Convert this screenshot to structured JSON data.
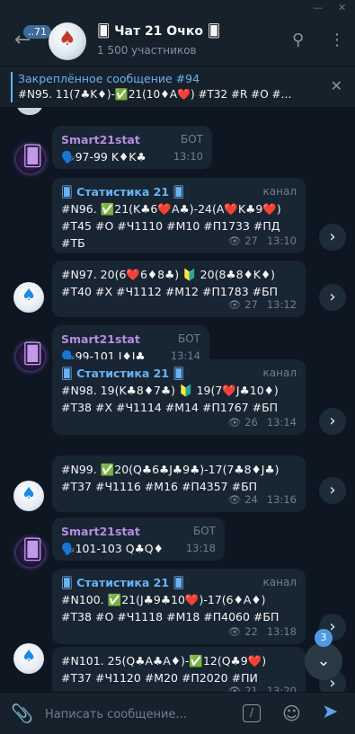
{
  "window": {
    "minimize": "—",
    "close": "✕"
  },
  "header": {
    "back_icon": "arrow-left-icon",
    "unread_count": "..71",
    "title": "🂠 Чат 21 Очко 🂠",
    "subtitle": "1 500 участников",
    "search_icon": "search-icon",
    "menu_icon": "more-vertical-icon"
  },
  "pinned": {
    "title": "Закреплённое сообщение #94",
    "text": "#N95. 11(7♣K♦)-✅21(10♦A❤️) #T32 #R #O #…"
  },
  "messages": [
    {
      "type": "bot",
      "sender": "Smart21stat",
      "tag": "БОТ",
      "text": "🗣️97-99 K♦K♣",
      "time": "13:10"
    },
    {
      "type": "forward",
      "channel": "🂠 Статистика 21 🂠",
      "tag": "канал",
      "text": "#N96. ✅21(K♣6❤️A♣)-24(A❤️K♣9❤️) #T45 #O #Ч1110 #M10 #П1733 #ПД #ТБ",
      "views": "27",
      "time": "13:10"
    },
    {
      "type": "channel",
      "text": "#N97. 20(6❤️6♦8♣) 🔰 20(8♣8♦K♦) #T40 #X #Ч1112 #M12 #П1783 #БП",
      "views": "27",
      "time": "13:12"
    },
    {
      "type": "bot",
      "sender": "Smart21stat",
      "tag": "БОТ",
      "text": "🗣️99-101 J♦J♣",
      "time": "13:14"
    },
    {
      "type": "forward",
      "channel": "🂠 Статистика 21 🂠",
      "tag": "канал",
      "text": "#N98. 19(K♣8♦7♣) 🔰 19(7❤️J♣10♦) #T38 #X #Ч1114 #M14 #П1767 #БП",
      "views": "26",
      "time": "13:14"
    },
    {
      "type": "channel",
      "text": "#N99. ✅20(Q♣6♣J♣9♣)-17(7♣8♦J♣) #T37 #Ч1116 #M16 #П4357 #БП",
      "views": "24",
      "time": "13:16"
    },
    {
      "type": "bot",
      "sender": "Smart21stat",
      "tag": "БОТ",
      "text": "🗣️101-103 Q♣Q♦",
      "time": "13:18"
    },
    {
      "type": "forward",
      "channel": "🂠 Статистика 21 🂠",
      "tag": "канал",
      "text": "#N100. ✅21(J♣9♣10❤️)-17(6♦A♦) #T38 #O #Ч1118 #M18 #П4060 #БП",
      "views": "22",
      "time": "13:18"
    },
    {
      "type": "channel",
      "text": "#N101. 25(Q♣A♣A♦)-✅12(Q♣9❤️) #T37 #Ч1120 #M20 #П2020 #ПИ",
      "views": "21",
      "time": "13:20"
    }
  ],
  "scroll": {
    "badge": "3"
  },
  "composer": {
    "placeholder": "Написать сообщение..."
  },
  "colors": {
    "accent": "#6ab2f2",
    "bg": "#0e1621",
    "bubble": "#182533",
    "bot_name": "#b38fe0"
  }
}
